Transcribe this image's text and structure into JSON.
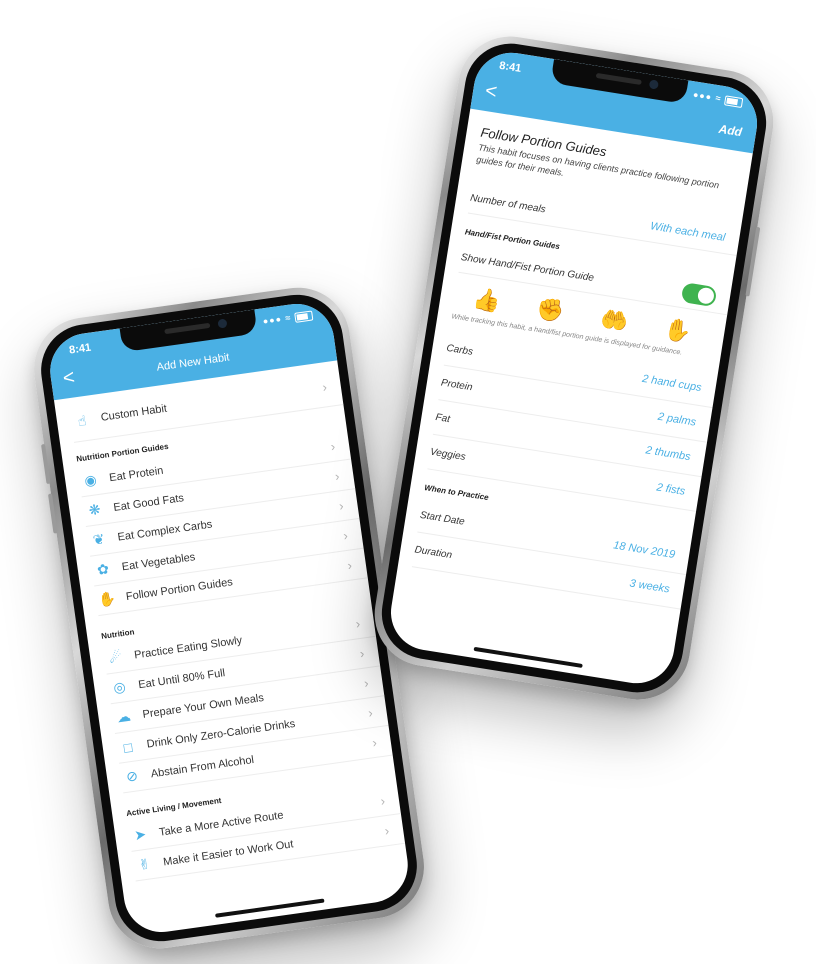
{
  "left_phone": {
    "status_time": "8:41",
    "nav_title": "Add New Habit",
    "back_label": "<",
    "custom_habit": {
      "label": "Custom Habit",
      "icon": "hand-pointer-icon"
    },
    "sections": [
      {
        "title": "Nutrition Portion Guides",
        "items": [
          {
            "label": "Eat Protein",
            "icon": "steak-icon"
          },
          {
            "label": "Eat Good Fats",
            "icon": "avocado-icon"
          },
          {
            "label": "Eat Complex Carbs",
            "icon": "leaf-icon"
          },
          {
            "label": "Eat Vegetables",
            "icon": "vegetable-icon"
          },
          {
            "label": "Follow Portion Guides",
            "icon": "hand-icon"
          }
        ]
      },
      {
        "title": "Nutrition",
        "items": [
          {
            "label": "Practice Eating Slowly",
            "icon": "turtle-icon"
          },
          {
            "label": "Eat Until 80% Full",
            "icon": "plate-icon"
          },
          {
            "label": "Prepare Your Own Meals",
            "icon": "chef-hat-icon"
          },
          {
            "label": "Drink Only Zero-Calorie Drinks",
            "icon": "glass-icon"
          },
          {
            "label": "Abstain From Alcohol",
            "icon": "no-alcohol-icon"
          }
        ]
      },
      {
        "title": "Active Living / Movement",
        "items": [
          {
            "label": "Take a More Active Route",
            "icon": "runner-icon"
          },
          {
            "label": "Make it Easier to Work Out",
            "icon": "hand-wave-icon"
          }
        ]
      }
    ]
  },
  "right_phone": {
    "status_time": "8:41",
    "back_label": "<",
    "add_label": "Add",
    "title": "Follow Portion Guides",
    "description": "This habit focuses on having clients practice following portion guides for their meals.",
    "meals_label": "Number of meals",
    "meals_value": "With each meal",
    "hand_section": "Hand/Fist Portion Guides",
    "toggle_label": "Show Hand/Fist Portion Guide",
    "hand_note": "While tracking this habit, a hand/fist portion guide is displayed for guidance.",
    "portions": [
      {
        "label": "Carbs",
        "value": "2 hand cups"
      },
      {
        "label": "Protein",
        "value": "2 palms"
      },
      {
        "label": "Fat",
        "value": "2 thumbs"
      },
      {
        "label": "Veggies",
        "value": "2 fists"
      }
    ],
    "practice_section": "When to Practice",
    "start_label": "Start Date",
    "start_value": "18 Nov 2019",
    "duration_label": "Duration",
    "duration_value": "3 weeks"
  }
}
